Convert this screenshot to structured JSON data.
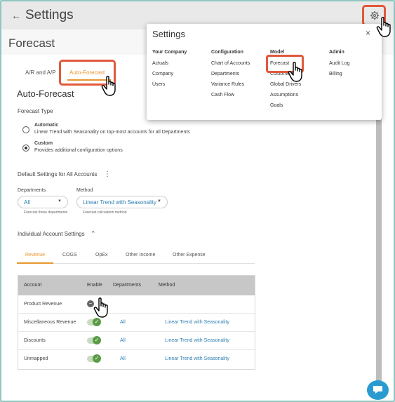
{
  "topbar": {
    "title": "Settings"
  },
  "page": {
    "title": "Forecast"
  },
  "tabs": [
    {
      "label": "A/R and A/P"
    },
    {
      "label": "Auto-Forecast"
    }
  ],
  "auto_forecast": {
    "heading": "Auto-Forecast",
    "forecast_type_label": "Forecast Type",
    "options": [
      {
        "title": "Automatic",
        "desc": "Linear Trend with Seasonality on top-most accounts for all Departments",
        "selected": false
      },
      {
        "title": "Custom",
        "desc": "Provides additional configuration options",
        "selected": true
      }
    ],
    "defaults_label": "Default Settings for All Accounts",
    "departments_label": "Departments",
    "departments_value": "All",
    "departments_hint": "Forecast these departments",
    "method_label": "Method",
    "method_value": "Linear Trend with Seasonality",
    "method_hint": "Forecast calculation method",
    "individual_label": "Individual Account Settings"
  },
  "subtabs": [
    "Revenue",
    "COGS",
    "OpEx",
    "Other Income",
    "Other Expense"
  ],
  "table": {
    "headers": [
      "Account",
      "Enable",
      "Departments",
      "Method"
    ],
    "rows": [
      {
        "account": "Product Revenue",
        "enabled": false,
        "departments": "",
        "method": ""
      },
      {
        "account": "Miscellaneous Revenue",
        "enabled": true,
        "departments": "All",
        "method": "Linear Trend with Seasonality"
      },
      {
        "account": "Discounts",
        "enabled": true,
        "departments": "All",
        "method": "Linear Trend with Seasonality"
      },
      {
        "account": "Unmapped",
        "enabled": true,
        "departments": "All",
        "method": "Linear Trend with Seasonality"
      }
    ]
  },
  "popup": {
    "title": "Settings",
    "close": "×",
    "columns": [
      {
        "header": "Your Company",
        "items": [
          "Actuals",
          "Company",
          "Users"
        ]
      },
      {
        "header": "Configuration",
        "items": [
          "Chart of Accounts",
          "Departments",
          "Variance Rules",
          "Cash Flow"
        ]
      },
      {
        "header": "Model",
        "items": [
          "Forecast",
          "Customers",
          "Global Drivers",
          "Assumptions",
          "Goals"
        ]
      },
      {
        "header": "Admin",
        "items": [
          "Audit Log",
          "Billing"
        ]
      }
    ]
  },
  "colors": {
    "accent_orange": "#e8962e",
    "highlight_red": "#e2583b",
    "link_blue": "#2f7fb1",
    "toggle_green": "#5a9c45"
  }
}
